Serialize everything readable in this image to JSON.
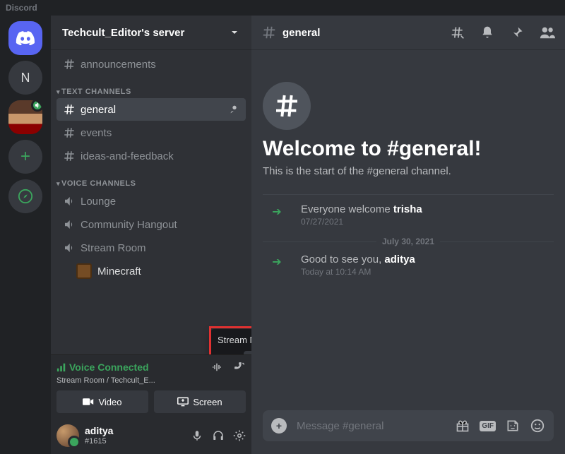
{
  "app_title": "Discord",
  "server": {
    "name": "Techcult_Editor's server"
  },
  "rail": {
    "n_label": "N"
  },
  "categories": {
    "text": {
      "label": "TEXT CHANNELS"
    },
    "voice": {
      "label": "VOICE CHANNELS"
    }
  },
  "text_channels": [
    {
      "name": "announcements"
    },
    {
      "name": "general"
    },
    {
      "name": "events"
    },
    {
      "name": "ideas-and-feedback"
    }
  ],
  "voice_channels": [
    {
      "name": "Lounge"
    },
    {
      "name": "Community Hangout"
    },
    {
      "name": "Stream Room"
    }
  ],
  "voice_user": {
    "game": "Minecraft"
  },
  "stream_popover": {
    "title": "Stream Minecraft"
  },
  "voice_panel": {
    "status": "Voice Connected",
    "sub": "Stream Room / Techcult_E...",
    "video_label": "Video",
    "screen_label": "Screen"
  },
  "user": {
    "name": "aditya",
    "tag": "#1615"
  },
  "chat": {
    "channel": "general",
    "welcome_title": "Welcome to #general!",
    "welcome_sub": "This is the start of the #general channel."
  },
  "messages": [
    {
      "prefix": "Everyone welcome ",
      "user": "trisha",
      "ts": "07/27/2021"
    },
    {
      "prefix": "Good to see you, ",
      "user": "aditya",
      "ts": "Today at 10:14 AM"
    }
  ],
  "date_divider": "July 30, 2021",
  "composer": {
    "placeholder": "Message #general"
  }
}
